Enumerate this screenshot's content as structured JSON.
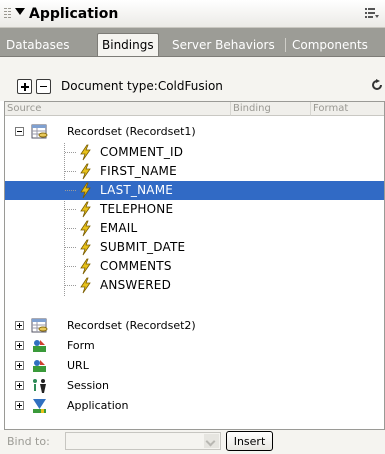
{
  "panel": {
    "title": "Application"
  },
  "tabs": [
    {
      "label": "Databases",
      "active": false
    },
    {
      "label": "Bindings",
      "active": true
    },
    {
      "label": "Server Behaviors",
      "active": false
    },
    {
      "label": "Components",
      "active": false
    }
  ],
  "toolbar": {
    "doc_type": "Document type:ColdFusion"
  },
  "columns": {
    "source": "Source",
    "binding": "Binding",
    "format": "Format"
  },
  "tree": {
    "recordset1": {
      "label": "Recordset (Recordset1)",
      "fields": [
        "COMMENT_ID",
        "FIRST_NAME",
        "LAST_NAME",
        "TELEPHONE",
        "EMAIL",
        "SUBMIT_DATE",
        "COMMENTS",
        "ANSWERED"
      ],
      "selected_field": "LAST_NAME"
    },
    "recordset2": "Recordset (Recordset2)",
    "form": "Form",
    "url": "URL",
    "session": "Session",
    "application": "Application"
  },
  "bottom": {
    "bind_to_label": "Bind to:",
    "insert_label": "Insert"
  },
  "colors": {
    "selection": "#316ac5",
    "tabbar": "#9c9c96",
    "panel_bg": "#f5f4f0"
  }
}
